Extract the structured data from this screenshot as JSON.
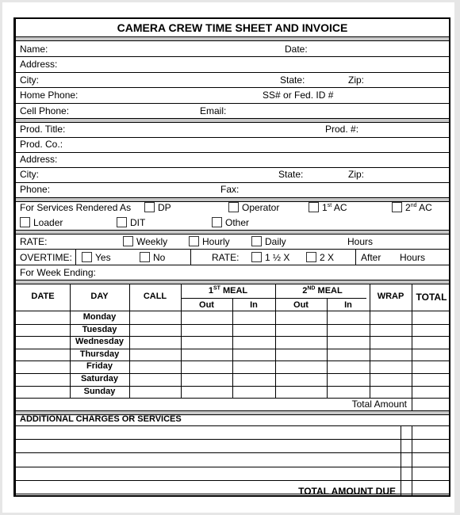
{
  "title": "CAMERA CREW TIME SHEET AND INVOICE",
  "personal": {
    "name": "Name:",
    "date": "Date:",
    "address": "Address:",
    "city": "City:",
    "state": "State:",
    "zip": "Zip:",
    "home_phone": "Home Phone:",
    "ssn": "SS# or Fed. ID #",
    "cell_phone": "Cell Phone:",
    "email": "Email:"
  },
  "production": {
    "title": "Prod. Title:",
    "number": "Prod. #:",
    "company": "Prod. Co.:",
    "address": "Address:",
    "city": "City:",
    "state": "State:",
    "zip": "Zip:",
    "phone": "Phone:",
    "fax": "Fax:"
  },
  "services": {
    "label": "For Services Rendered As",
    "dp": "DP",
    "operator": "Operator",
    "first_ac_num": "1",
    "first_ac_sup": "st",
    "first_ac_text": " AC",
    "second_ac_num": "2",
    "second_ac_sup": "nd",
    "second_ac_text": " AC",
    "loader": "Loader",
    "dit": "DIT",
    "other": "Other"
  },
  "rate": {
    "label": "RATE:",
    "weekly": "Weekly",
    "hourly": "Hourly",
    "daily": "Daily",
    "hours": "Hours"
  },
  "overtime": {
    "label": "OVERTIME:",
    "yes": "Yes",
    "no": "No",
    "rate_label": "RATE:",
    "one_half": "1 ½ X",
    "two": "2 X",
    "after": "After",
    "hours": "Hours"
  },
  "week_ending": "For Week Ending:",
  "table": {
    "date": "DATE",
    "day": "DAY",
    "call": "CALL",
    "meal1_num": "1",
    "meal1_sup": "ST",
    "meal1_text": " MEAL",
    "meal2_num": "2",
    "meal2_sup": "ND",
    "meal2_text": " MEAL",
    "out": "Out",
    "in": "In",
    "wrap": "WRAP",
    "total": "TOTAL",
    "days": [
      "Monday",
      "Tuesday",
      "Wednesday",
      "Thursday",
      "Friday",
      "Saturday",
      "Sunday"
    ],
    "total_amount": "Total Amount"
  },
  "additional": {
    "header": "ADDITIONAL CHARGES OR SERVICES",
    "total_due": "TOTAL AMOUNT DUE"
  }
}
